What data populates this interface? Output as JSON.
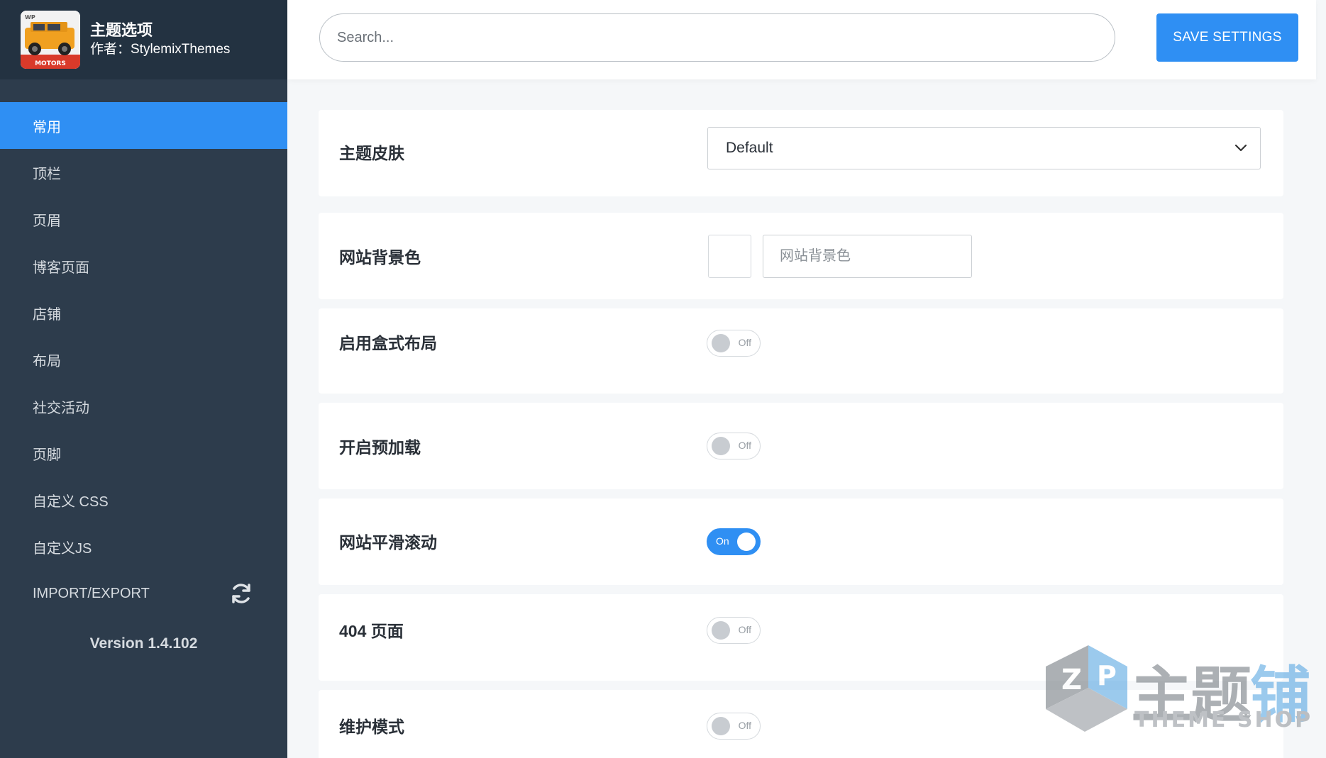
{
  "brand": {
    "title": "主题选项",
    "author": "作者：StylemixThemes",
    "logo_text_top": "WP",
    "logo_text_bottom": "MOTORS"
  },
  "sidebar": {
    "items": [
      {
        "label": "常用",
        "active": true
      },
      {
        "label": "顶栏"
      },
      {
        "label": "页眉"
      },
      {
        "label": "博客页面"
      },
      {
        "label": "店铺"
      },
      {
        "label": "布局"
      },
      {
        "label": "社交活动"
      },
      {
        "label": "页脚"
      },
      {
        "label": "自定义 CSS"
      },
      {
        "label": "自定义JS"
      },
      {
        "label": "IMPORT/EXPORT",
        "icon": "sync-icon"
      }
    ],
    "version": "Version 1.4.102"
  },
  "header": {
    "search_placeholder": "Search...",
    "save_label": "SAVE SETTINGS"
  },
  "settings": {
    "theme_skin": {
      "label": "主题皮肤",
      "value": "Default"
    },
    "site_bg_color": {
      "label": "网站背景色",
      "placeholder": "网站背景色"
    },
    "boxed_layout": {
      "label": "启用盒式布局",
      "state": "Off"
    },
    "preloader": {
      "label": "开启预加载",
      "state": "Off"
    },
    "smooth_scroll": {
      "label": "网站平滑滚动",
      "state": "On"
    },
    "page_404": {
      "label": "404 页面",
      "state": "Off"
    },
    "maintenance": {
      "label": "维护模式",
      "state": "Off"
    }
  },
  "watermark": {
    "cn_part1": "主题",
    "cn_part2": "铺",
    "en": "THEME SHOP"
  },
  "colors": {
    "accent": "#2f8ff3",
    "sidebar_bg": "#2d3c4c",
    "brand_bg": "#233241",
    "page_bg": "#f5f7f9"
  }
}
